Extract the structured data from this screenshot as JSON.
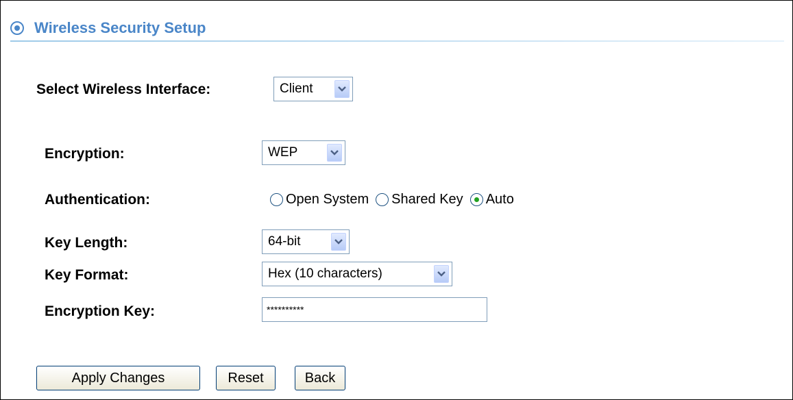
{
  "header": {
    "title": "Wireless Security Setup",
    "icon": "radio-target-icon",
    "accent_color": "#4a86c8"
  },
  "interface": {
    "label": "Select Wireless Interface:",
    "selected": "Client"
  },
  "encryption": {
    "label": "Encryption:",
    "selected": "WEP"
  },
  "authentication": {
    "label": "Authentication:",
    "options": [
      {
        "label": "Open System",
        "checked": false
      },
      {
        "label": "Shared Key",
        "checked": false
      },
      {
        "label": "Auto",
        "checked": true
      }
    ]
  },
  "key_length": {
    "label": "Key Length:",
    "selected": "64-bit"
  },
  "key_format": {
    "label": "Key Format:",
    "selected": "Hex (10 characters)"
  },
  "encryption_key": {
    "label": "Encryption Key:",
    "value": "**********"
  },
  "buttons": {
    "apply": "Apply Changes",
    "reset": "Reset",
    "back": "Back"
  }
}
